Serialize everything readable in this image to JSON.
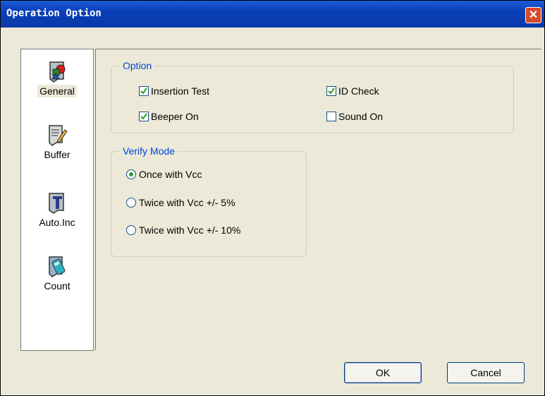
{
  "window": {
    "title": "Operation Option",
    "close_glyph": "✕"
  },
  "sidebar": {
    "items": [
      {
        "label": "General",
        "icon": "general-icon",
        "active": true
      },
      {
        "label": "Buffer",
        "icon": "buffer-icon",
        "active": false
      },
      {
        "label": "Auto.Inc",
        "icon": "auto-inc-icon",
        "active": false
      },
      {
        "label": "Count",
        "icon": "count-icon",
        "active": false
      }
    ]
  },
  "option_group": {
    "legend": "Option",
    "insertion_test": {
      "label": "Insertion Test",
      "checked": true
    },
    "id_check": {
      "label": "ID Check",
      "checked": true
    },
    "beeper_on": {
      "label": "Beeper On",
      "checked": true
    },
    "sound_on": {
      "label": "Sound On",
      "checked": false
    }
  },
  "verify_group": {
    "legend": "Verify Mode",
    "options": [
      {
        "label": "Once with Vcc",
        "selected": true
      },
      {
        "label": "Twice with Vcc +/- 5%",
        "selected": false
      },
      {
        "label": "Twice with Vcc +/- 10%",
        "selected": false
      }
    ]
  },
  "buttons": {
    "ok": "OK",
    "cancel": "Cancel"
  },
  "colors": {
    "title_bar": "#0a3fb8",
    "legend_text": "#0046d5",
    "check_mark": "#21a121"
  }
}
